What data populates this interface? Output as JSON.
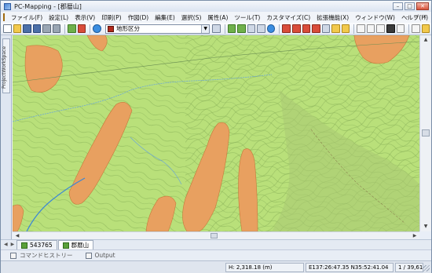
{
  "window": {
    "title": "PC-Mapping - [郡暦山]",
    "buttons": [
      "–",
      "□",
      "✕"
    ]
  },
  "menubar": {
    "items": [
      "ファイル(F)",
      "設定(L)",
      "表示(V)",
      "印刷(P)",
      "作図(D)",
      "編集(E)",
      "選択(S)",
      "属性(A)",
      "ツール(T)",
      "カスタマイズ(C)",
      "拡張機能(X)",
      "ウィンドウ(W)",
      "ヘルプ(H)"
    ],
    "mdi_buttons": [
      "–",
      "▫",
      "×"
    ]
  },
  "toolbar": {
    "layer_select_value": "地形区分",
    "layer_color": "#b22a1c"
  },
  "side_panel": {
    "label": "ProjectWorkSpace"
  },
  "map": {
    "background_color": "#b9e07a",
    "polygon_color": "#e8a060"
  },
  "document_tabs": [
    {
      "label": "543765",
      "active": false
    },
    {
      "label": "郡暦山",
      "active": true
    }
  ],
  "bottom_tabs": [
    {
      "label": "コマンドヒストリー",
      "icon": "console-icon"
    },
    {
      "label": "Output",
      "icon": "output-icon"
    }
  ],
  "status": {
    "height": "H: 2,318.18 (m)",
    "coords": "E137:26:47.35 N35:52:41.04",
    "scale": "1 / 39,617"
  }
}
